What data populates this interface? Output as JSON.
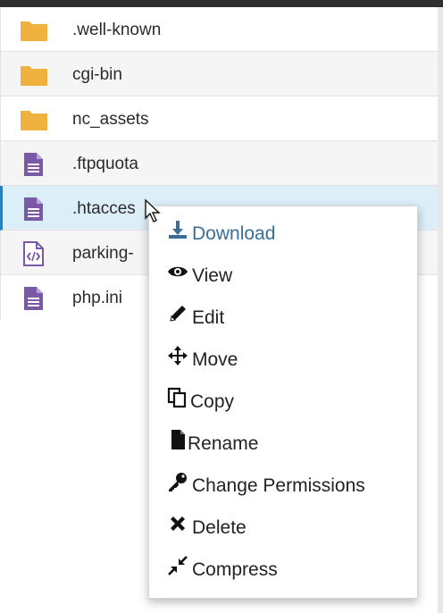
{
  "files": [
    {
      "name": ".well-known",
      "icon": "folder-icon"
    },
    {
      "name": "cgi-bin",
      "icon": "folder-icon"
    },
    {
      "name": "nc_assets",
      "icon": "folder-icon"
    },
    {
      "name": ".ftpquota",
      "icon": "file-text-icon"
    },
    {
      "name": ".htacces",
      "icon": "file-text-icon",
      "selected": true
    },
    {
      "name": "parking-",
      "icon": "file-code-icon"
    },
    {
      "name": "php.ini",
      "icon": "file-text-icon"
    }
  ],
  "context_menu": {
    "items": [
      {
        "label": "Download",
        "icon": "download-icon"
      },
      {
        "label": "View",
        "icon": "eye-icon"
      },
      {
        "label": "Edit",
        "icon": "pencil-icon"
      },
      {
        "label": "Move",
        "icon": "move-arrows-icon"
      },
      {
        "label": "Copy",
        "icon": "copy-icon"
      },
      {
        "label": "Rename",
        "icon": "file-icon"
      },
      {
        "label": "Change Permissions",
        "icon": "key-icon"
      },
      {
        "label": "Delete",
        "icon": "x-icon"
      },
      {
        "label": "Compress",
        "icon": "compress-icon"
      }
    ]
  },
  "colors": {
    "folder": "#f0b23e",
    "file": "#7a5aa6",
    "selected_bg": "#dceef8",
    "selected_border": "#2a7fbf",
    "download_accent": "#3a6e99"
  }
}
